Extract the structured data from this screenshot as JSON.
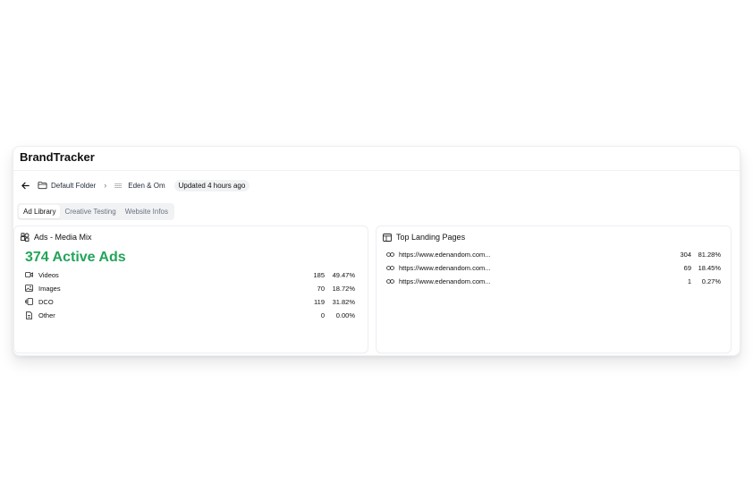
{
  "app": {
    "title": "BrandTracker"
  },
  "breadcrumb": {
    "folder": "Default Folder",
    "brand": "Eden & Om",
    "updated": "Updated 4 hours ago"
  },
  "tabs": [
    {
      "label": "Ad Library",
      "active": true
    },
    {
      "label": "Creative Testing",
      "active": false
    },
    {
      "label": "Website Infos",
      "active": false
    }
  ],
  "media_mix": {
    "title": "Ads - Media Mix",
    "active_ads": "374 Active Ads",
    "rows": [
      {
        "icon": "video-icon",
        "label": "Videos",
        "count": "185",
        "percent": "49.47%"
      },
      {
        "icon": "image-icon",
        "label": "Images",
        "count": "70",
        "percent": "18.72%"
      },
      {
        "icon": "dco-icon",
        "label": "DCO",
        "count": "119",
        "percent": "31.82%"
      },
      {
        "icon": "other-icon",
        "label": "Other",
        "count": "0",
        "percent": "0.00%"
      }
    ]
  },
  "landing_pages": {
    "title": "Top Landing Pages",
    "rows": [
      {
        "url": "https://www.edenandom.com...",
        "count": "304",
        "percent": "81.28%"
      },
      {
        "url": "https://www.edenandom.com...",
        "count": "69",
        "percent": "18.45%"
      },
      {
        "url": "https://www.edenandom.com...",
        "count": "1",
        "percent": "0.27%"
      }
    ]
  },
  "colors": {
    "active_ads_green": "#23a45a",
    "arrow_red": "#f0401c"
  }
}
